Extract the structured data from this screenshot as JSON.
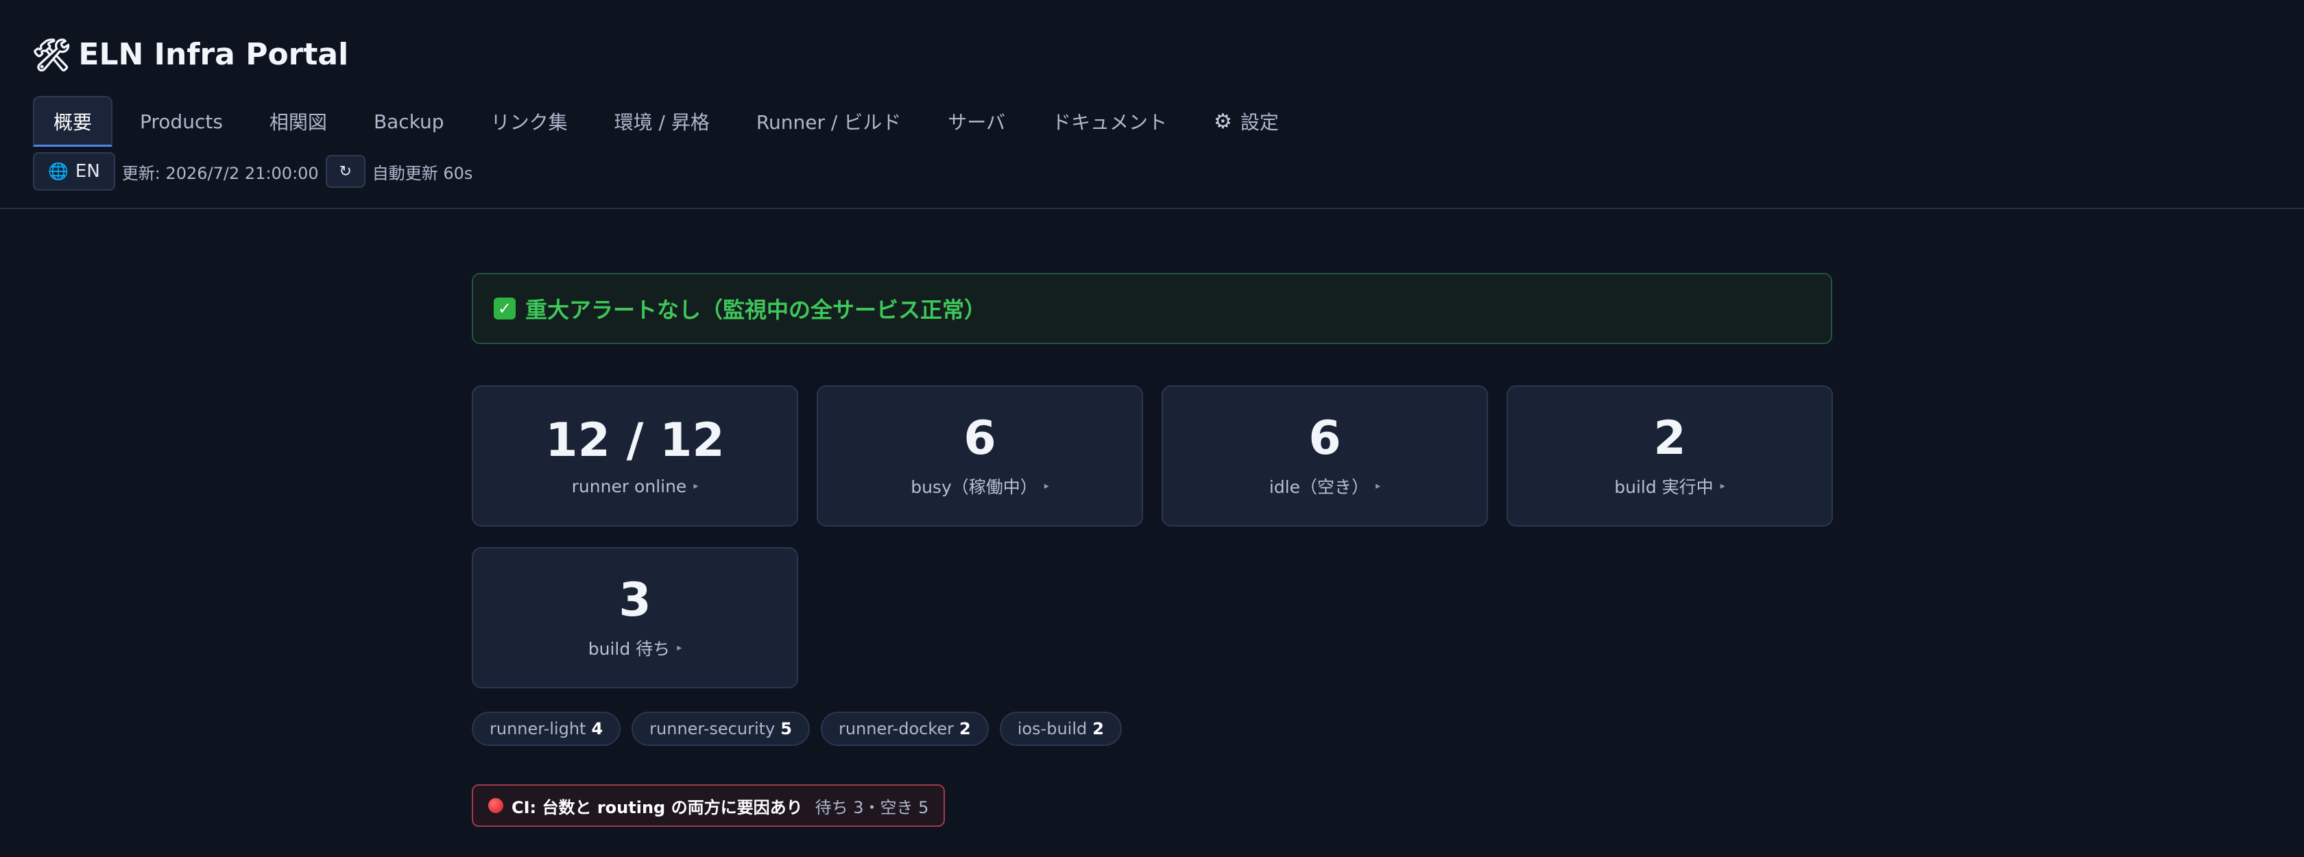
{
  "header": {
    "icon": "hammer-wrench-icon",
    "title": "ELN Infra Portal"
  },
  "nav": {
    "tabs": [
      {
        "label": "概要",
        "active": true
      },
      {
        "label": "Products"
      },
      {
        "label": "相関図"
      },
      {
        "label": "Backup"
      },
      {
        "label": "リンク集"
      },
      {
        "label": "環境 / 昇格"
      },
      {
        "label": "Runner / ビルド"
      },
      {
        "label": "サーバ"
      },
      {
        "label": "ドキュメント"
      },
      {
        "label": "設定",
        "icon": "gear-icon"
      }
    ]
  },
  "subbar": {
    "language": "EN",
    "updated": "更新: 2026/7/2 21:00:00",
    "refresh_icon": "↻",
    "auto_refresh": "自動更新 60s"
  },
  "alert": {
    "icon": "check-icon",
    "text": "重大アラートなし（監視中の全サービス正常）",
    "color": "#3fc75a"
  },
  "stats": [
    {
      "value": "12 / 12",
      "label": "runner online"
    },
    {
      "value": "6",
      "label": "busy（稼働中）"
    },
    {
      "value": "6",
      "label": "idle（空き）"
    },
    {
      "value": "2",
      "label": "build 実行中"
    },
    {
      "value": "3",
      "label": "build 待ち"
    }
  ],
  "runner_groups": [
    {
      "name": "runner-light",
      "count": "4"
    },
    {
      "name": "runner-security",
      "count": "5"
    },
    {
      "name": "runner-docker",
      "count": "2"
    },
    {
      "name": "ios-build",
      "count": "2"
    }
  ],
  "ci_status": {
    "title": "CI: 台数と routing の両方に要因あり",
    "detail": "待ち 3・空き 5",
    "color": "#d31f2a"
  }
}
